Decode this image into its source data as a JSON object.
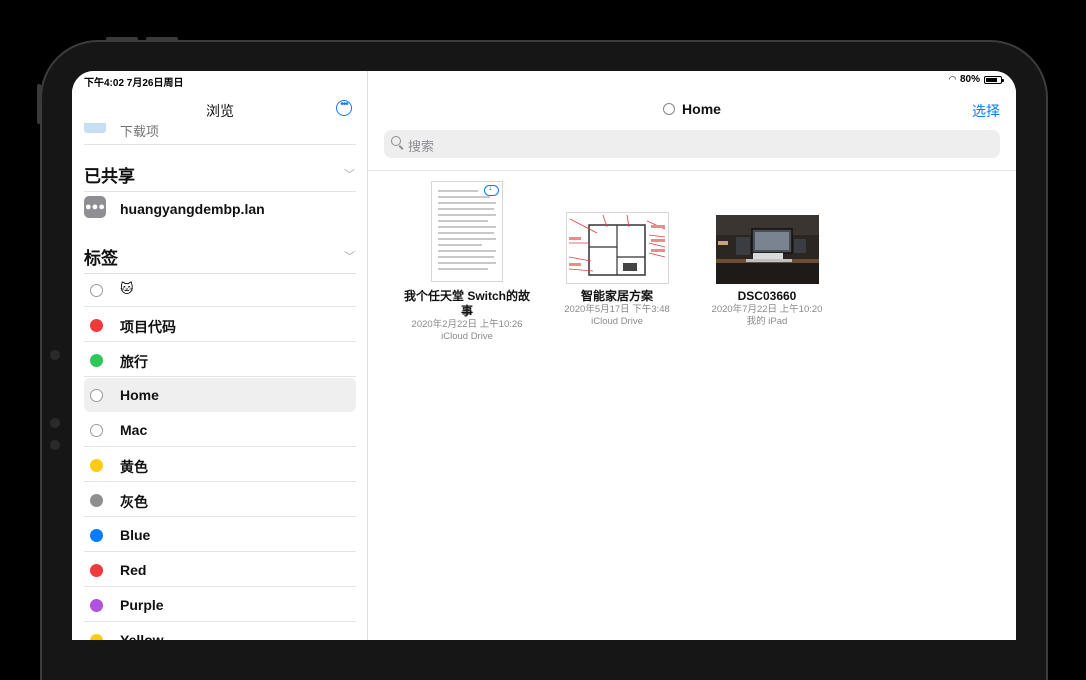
{
  "status_bar": {
    "time": "下午4:02  7月26日周日",
    "battery": "80%"
  },
  "sidebar": {
    "title": "浏览",
    "more_icon": "ellipsis-circle-icon",
    "hidden_item": "下载项",
    "shared_section": "已共享",
    "shared_items": [
      {
        "label": "huangyangdembp.lan",
        "icon": "server-icon"
      }
    ],
    "tags_section": "标签",
    "tags": [
      {
        "label": "🐱",
        "color": "",
        "emoji": true
      },
      {
        "label": "项目代码",
        "color": "#f0393a"
      },
      {
        "label": "旅行",
        "color": "#2fc75a"
      },
      {
        "label": "Home",
        "color": "",
        "selected": true
      },
      {
        "label": "Mac",
        "color": ""
      },
      {
        "label": "黄色",
        "color": "#ffcb10"
      },
      {
        "label": "灰色",
        "color": "#8e8e93"
      },
      {
        "label": "Blue",
        "color": "#0a7aff"
      },
      {
        "label": "Red",
        "color": "#f0393a"
      },
      {
        "label": "Purple",
        "color": "#af52de"
      },
      {
        "label": "Yellow",
        "color": "#ffcb10"
      }
    ]
  },
  "main": {
    "title": "Home",
    "select_label": "选择",
    "search_placeholder": "搜索",
    "files": [
      {
        "name": "我个任天堂 Switch的故事",
        "date": "2020年2月22日 上午10:26",
        "location": "iCloud Drive",
        "kind": "document"
      },
      {
        "name": "智能家居方案",
        "date": "2020年5月17日 下午3:48",
        "location": "iCloud Drive",
        "kind": "floorplan"
      },
      {
        "name": "DSC03660",
        "date": "2020年7月22日 上午10:20",
        "location": "我的 iPad",
        "kind": "photo"
      }
    ]
  },
  "colors": {
    "accent": "#0a7aff",
    "bezel": "#161616"
  }
}
